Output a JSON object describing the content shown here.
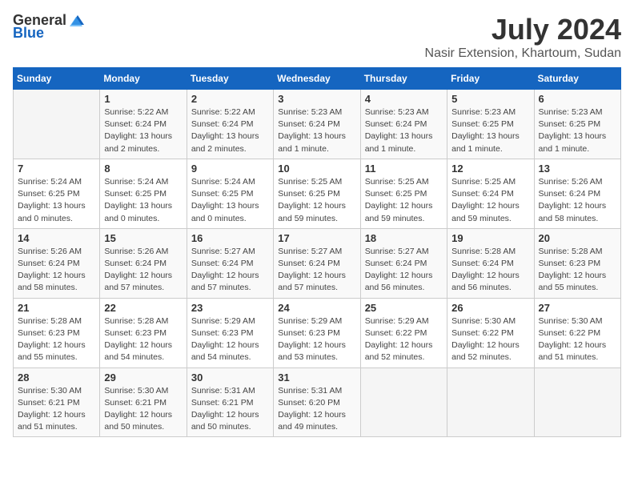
{
  "logo": {
    "general": "General",
    "blue": "Blue"
  },
  "header": {
    "month": "July 2024",
    "location": "Nasir Extension, Khartoum, Sudan"
  },
  "weekdays": [
    "Sunday",
    "Monday",
    "Tuesday",
    "Wednesday",
    "Thursday",
    "Friday",
    "Saturday"
  ],
  "weeks": [
    [
      {
        "day": "",
        "sunrise": "",
        "sunset": "",
        "daylight": ""
      },
      {
        "day": "1",
        "sunrise": "Sunrise: 5:22 AM",
        "sunset": "Sunset: 6:24 PM",
        "daylight": "Daylight: 13 hours and 2 minutes."
      },
      {
        "day": "2",
        "sunrise": "Sunrise: 5:22 AM",
        "sunset": "Sunset: 6:24 PM",
        "daylight": "Daylight: 13 hours and 2 minutes."
      },
      {
        "day": "3",
        "sunrise": "Sunrise: 5:23 AM",
        "sunset": "Sunset: 6:24 PM",
        "daylight": "Daylight: 13 hours and 1 minute."
      },
      {
        "day": "4",
        "sunrise": "Sunrise: 5:23 AM",
        "sunset": "Sunset: 6:24 PM",
        "daylight": "Daylight: 13 hours and 1 minute."
      },
      {
        "day": "5",
        "sunrise": "Sunrise: 5:23 AM",
        "sunset": "Sunset: 6:25 PM",
        "daylight": "Daylight: 13 hours and 1 minute."
      },
      {
        "day": "6",
        "sunrise": "Sunrise: 5:23 AM",
        "sunset": "Sunset: 6:25 PM",
        "daylight": "Daylight: 13 hours and 1 minute."
      }
    ],
    [
      {
        "day": "7",
        "sunrise": "Sunrise: 5:24 AM",
        "sunset": "Sunset: 6:25 PM",
        "daylight": "Daylight: 13 hours and 0 minutes."
      },
      {
        "day": "8",
        "sunrise": "Sunrise: 5:24 AM",
        "sunset": "Sunset: 6:25 PM",
        "daylight": "Daylight: 13 hours and 0 minutes."
      },
      {
        "day": "9",
        "sunrise": "Sunrise: 5:24 AM",
        "sunset": "Sunset: 6:25 PM",
        "daylight": "Daylight: 13 hours and 0 minutes."
      },
      {
        "day": "10",
        "sunrise": "Sunrise: 5:25 AM",
        "sunset": "Sunset: 6:25 PM",
        "daylight": "Daylight: 12 hours and 59 minutes."
      },
      {
        "day": "11",
        "sunrise": "Sunrise: 5:25 AM",
        "sunset": "Sunset: 6:25 PM",
        "daylight": "Daylight: 12 hours and 59 minutes."
      },
      {
        "day": "12",
        "sunrise": "Sunrise: 5:25 AM",
        "sunset": "Sunset: 6:24 PM",
        "daylight": "Daylight: 12 hours and 59 minutes."
      },
      {
        "day": "13",
        "sunrise": "Sunrise: 5:26 AM",
        "sunset": "Sunset: 6:24 PM",
        "daylight": "Daylight: 12 hours and 58 minutes."
      }
    ],
    [
      {
        "day": "14",
        "sunrise": "Sunrise: 5:26 AM",
        "sunset": "Sunset: 6:24 PM",
        "daylight": "Daylight: 12 hours and 58 minutes."
      },
      {
        "day": "15",
        "sunrise": "Sunrise: 5:26 AM",
        "sunset": "Sunset: 6:24 PM",
        "daylight": "Daylight: 12 hours and 57 minutes."
      },
      {
        "day": "16",
        "sunrise": "Sunrise: 5:27 AM",
        "sunset": "Sunset: 6:24 PM",
        "daylight": "Daylight: 12 hours and 57 minutes."
      },
      {
        "day": "17",
        "sunrise": "Sunrise: 5:27 AM",
        "sunset": "Sunset: 6:24 PM",
        "daylight": "Daylight: 12 hours and 57 minutes."
      },
      {
        "day": "18",
        "sunrise": "Sunrise: 5:27 AM",
        "sunset": "Sunset: 6:24 PM",
        "daylight": "Daylight: 12 hours and 56 minutes."
      },
      {
        "day": "19",
        "sunrise": "Sunrise: 5:28 AM",
        "sunset": "Sunset: 6:24 PM",
        "daylight": "Daylight: 12 hours and 56 minutes."
      },
      {
        "day": "20",
        "sunrise": "Sunrise: 5:28 AM",
        "sunset": "Sunset: 6:23 PM",
        "daylight": "Daylight: 12 hours and 55 minutes."
      }
    ],
    [
      {
        "day": "21",
        "sunrise": "Sunrise: 5:28 AM",
        "sunset": "Sunset: 6:23 PM",
        "daylight": "Daylight: 12 hours and 55 minutes."
      },
      {
        "day": "22",
        "sunrise": "Sunrise: 5:28 AM",
        "sunset": "Sunset: 6:23 PM",
        "daylight": "Daylight: 12 hours and 54 minutes."
      },
      {
        "day": "23",
        "sunrise": "Sunrise: 5:29 AM",
        "sunset": "Sunset: 6:23 PM",
        "daylight": "Daylight: 12 hours and 54 minutes."
      },
      {
        "day": "24",
        "sunrise": "Sunrise: 5:29 AM",
        "sunset": "Sunset: 6:23 PM",
        "daylight": "Daylight: 12 hours and 53 minutes."
      },
      {
        "day": "25",
        "sunrise": "Sunrise: 5:29 AM",
        "sunset": "Sunset: 6:22 PM",
        "daylight": "Daylight: 12 hours and 52 minutes."
      },
      {
        "day": "26",
        "sunrise": "Sunrise: 5:30 AM",
        "sunset": "Sunset: 6:22 PM",
        "daylight": "Daylight: 12 hours and 52 minutes."
      },
      {
        "day": "27",
        "sunrise": "Sunrise: 5:30 AM",
        "sunset": "Sunset: 6:22 PM",
        "daylight": "Daylight: 12 hours and 51 minutes."
      }
    ],
    [
      {
        "day": "28",
        "sunrise": "Sunrise: 5:30 AM",
        "sunset": "Sunset: 6:21 PM",
        "daylight": "Daylight: 12 hours and 51 minutes."
      },
      {
        "day": "29",
        "sunrise": "Sunrise: 5:30 AM",
        "sunset": "Sunset: 6:21 PM",
        "daylight": "Daylight: 12 hours and 50 minutes."
      },
      {
        "day": "30",
        "sunrise": "Sunrise: 5:31 AM",
        "sunset": "Sunset: 6:21 PM",
        "daylight": "Daylight: 12 hours and 50 minutes."
      },
      {
        "day": "31",
        "sunrise": "Sunrise: 5:31 AM",
        "sunset": "Sunset: 6:20 PM",
        "daylight": "Daylight: 12 hours and 49 minutes."
      },
      {
        "day": "",
        "sunrise": "",
        "sunset": "",
        "daylight": ""
      },
      {
        "day": "",
        "sunrise": "",
        "sunset": "",
        "daylight": ""
      },
      {
        "day": "",
        "sunrise": "",
        "sunset": "",
        "daylight": ""
      }
    ]
  ]
}
